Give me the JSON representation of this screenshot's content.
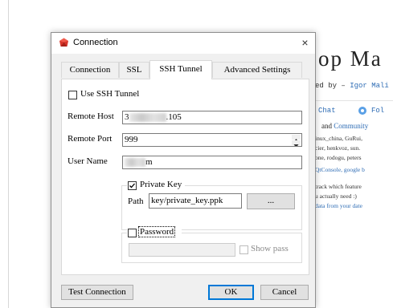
{
  "background": {
    "heading": "op Ma",
    "byline_prefix": "ed by – ",
    "byline_link": "Igor Mali",
    "chat": "Chat",
    "follow": "Fol",
    "community_prefix": "and ",
    "community_link": "Community",
    "contributors": [
      "inux_china, GuRui,",
      "cier, henkvoz, sun.",
      "one, rodogu, peters"
    ],
    "qtconsole": "QtConsole, google b",
    "note": [
      "track which feature",
      "u actually need :)"
    ],
    "note_link": "data from your date"
  },
  "window": {
    "title": "Connection",
    "icon": "redis-gem-icon",
    "close_glyph": "×"
  },
  "tabs": [
    {
      "label": "Connection",
      "active": false
    },
    {
      "label": "SSL",
      "active": false
    },
    {
      "label": "SSH Tunnel",
      "active": true
    },
    {
      "label": "Advanced Settings",
      "active": false
    }
  ],
  "ssh": {
    "use_tunnel": {
      "label": "Use SSH Tunnel",
      "checked": false
    },
    "remote_host": {
      "label": "Remote Host",
      "value_prefix": "3",
      "value_suffix": ".105"
    },
    "remote_port": {
      "label": "Remote Port",
      "value": "999"
    },
    "user_name": {
      "label": "User Name",
      "value_suffix": "m"
    },
    "private_key": {
      "label": "Private Key",
      "checked": true,
      "path_label": "Path",
      "path_value": "key/private_key.ppk",
      "browse_label": "..."
    },
    "password": {
      "label": "Password",
      "checked": false,
      "value": "",
      "show_label": "Show pass",
      "show_checked": false
    }
  },
  "buttons": {
    "test": "Test Connection",
    "ok": "OK",
    "cancel": "Cancel"
  }
}
